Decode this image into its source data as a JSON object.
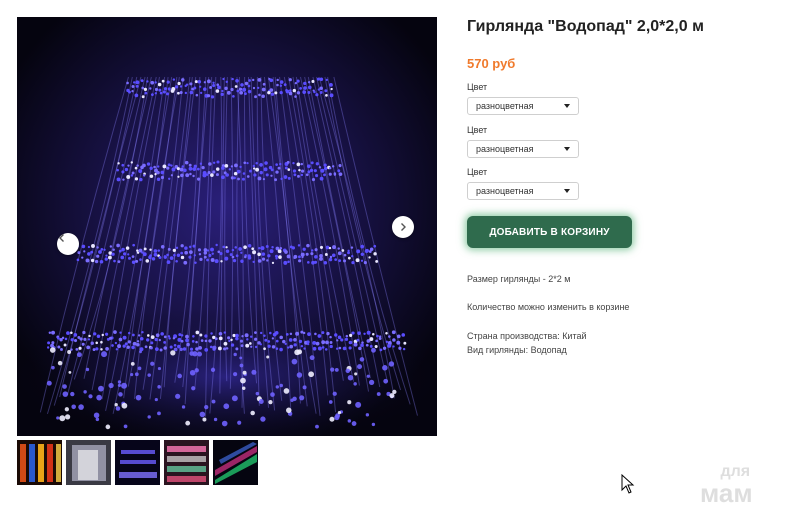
{
  "product": {
    "title": "Гирлянда \"Водопад\" 2,0*2,0 м",
    "price": "570 руб"
  },
  "options": [
    {
      "label": "Цвет",
      "value": "разноцветная"
    },
    {
      "label": "Цвет",
      "value": "разноцветная"
    },
    {
      "label": "Цвет",
      "value": "разноцветная"
    }
  ],
  "cart_button": "ДОБАВИТЬ В КОРЗИНУ",
  "details": [
    "Размер гирлянды - 2*2 м",
    "Количество можно изменить в корзине",
    "Страна производства: Китай",
    "Вид гирлянды: Водопад"
  ],
  "watermark": {
    "line1": "для",
    "line2": "мам"
  },
  "colors": {
    "price": "#f07a2c",
    "button": "#2f6b4d",
    "led": "#5a4dff"
  },
  "icons": {
    "prev": "chevron-left-icon",
    "next": "chevron-right-icon",
    "cursor": "mouse-cursor-icon"
  }
}
